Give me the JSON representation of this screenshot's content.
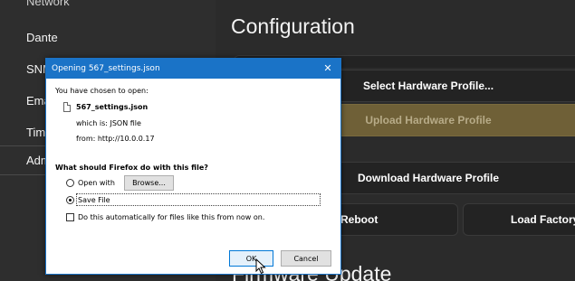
{
  "sidebar": {
    "items": [
      {
        "label": "Network"
      },
      {
        "label": "Dante"
      },
      {
        "label": "SNMP"
      },
      {
        "label": "Email"
      },
      {
        "label": "Time"
      },
      {
        "label": "Admin"
      }
    ]
  },
  "main": {
    "title": "Configuration",
    "buttons": {
      "select_profile": "Select Hardware Profile...",
      "upload_profile": "Upload Hardware Profile",
      "download_profile": "Download Hardware Profile",
      "reboot": "Reboot",
      "load_factory": "Load Factory"
    },
    "next_section_title": "Firmware Update"
  },
  "dialog": {
    "title": "Opening 567_settings.json",
    "chosen_text": "You have chosen to open:",
    "filename": "567_settings.json",
    "which_is": "which is: JSON file",
    "from": "from: http://10.0.0.17",
    "question": "What should Firefox do with this file?",
    "open_with_label": "Open with",
    "browse_label": "Browse...",
    "save_file_label": "Save File",
    "auto_label": "Do this automatically for files like this from now on.",
    "ok_label": "OK",
    "cancel_label": "Cancel",
    "selected_option": "Save File",
    "auto_checked": false
  },
  "colors": {
    "dialog_titlebar": "#1a73c7",
    "upload_button": "#6f6037",
    "background": "#2b2b2b"
  }
}
